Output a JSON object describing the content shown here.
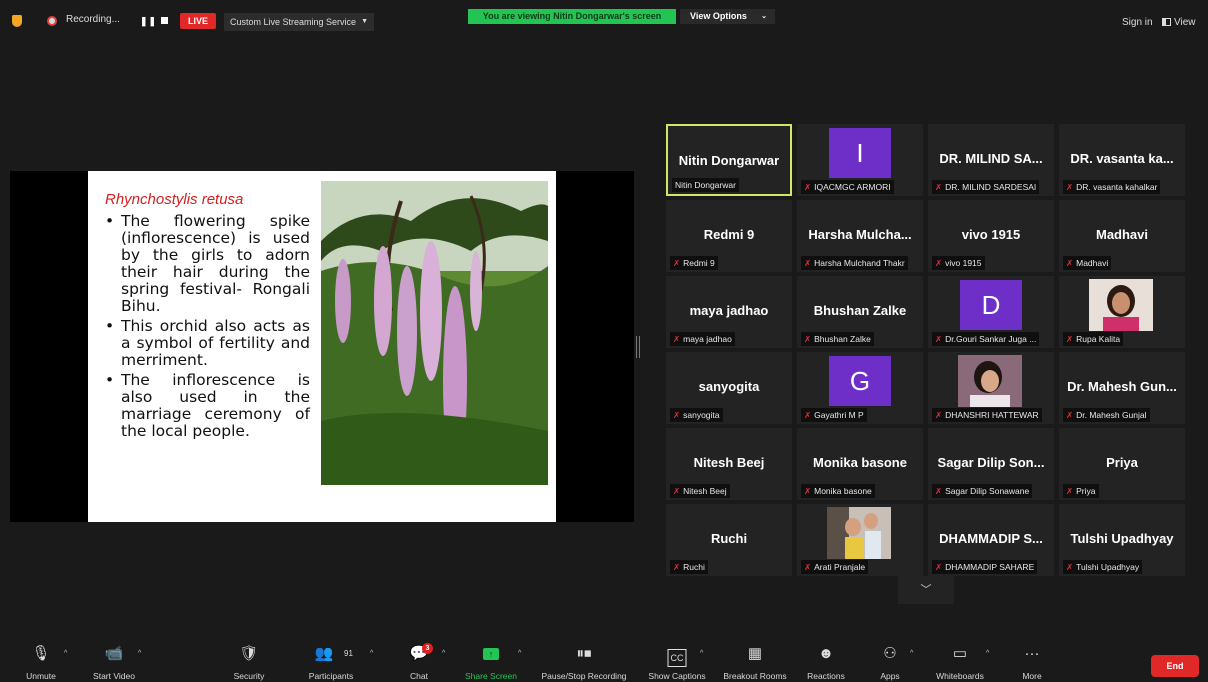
{
  "topbar": {
    "recording_label": "Recording...",
    "live_label": "LIVE",
    "stream_service": "Custom Live Streaming Service",
    "viewing_banner": "You are viewing Nitin Dongarwar's screen",
    "view_options": "View Options",
    "sign_in": "Sign in",
    "view": "View"
  },
  "slide": {
    "title": "Rhynchostylis retusa",
    "bullets": [
      "The flowering spike (inflorescence) is used by the girls to adorn their hair during the spring festival- Rongali Bihu.",
      "This orchid also acts as a symbol of fertility and merriment.",
      "The inflorescence is also used in the marriage ceremony of the local people."
    ]
  },
  "gallery": [
    {
      "display": "Nitin Dongarwar",
      "label": "Nitin Dongarwar",
      "type": "name",
      "active": true,
      "muted": false
    },
    {
      "display": "I",
      "label": "IQACMGC ARMORI",
      "type": "letter",
      "muted": true
    },
    {
      "display": "DR. MILIND SA...",
      "label": "DR. MILIND SARDESAI",
      "type": "name",
      "muted": true
    },
    {
      "display": "DR.  vasanta ka...",
      "label": "DR. vasanta kahalkar",
      "type": "name",
      "muted": true
    },
    {
      "display": "Redmi 9",
      "label": "Redmi 9",
      "type": "name",
      "muted": true
    },
    {
      "display": "Harsha  Mulcha...",
      "label": "Harsha Mulchand Thakr",
      "type": "name",
      "muted": true
    },
    {
      "display": "vivo 1915",
      "label": "vivo 1915",
      "type": "name",
      "muted": true
    },
    {
      "display": "Madhavi",
      "label": "Madhavi",
      "type": "name",
      "muted": true
    },
    {
      "display": "maya jadhao",
      "label": "maya jadhao",
      "type": "name",
      "muted": true
    },
    {
      "display": "Bhushan Zalke",
      "label": "Bhushan Zalke",
      "type": "name",
      "muted": true
    },
    {
      "display": "D",
      "label": "Dr.Gouri Sankar Juga ...",
      "type": "letter",
      "muted": true
    },
    {
      "display": "",
      "label": "Rupa Kalita",
      "type": "photo-woman",
      "muted": true
    },
    {
      "display": "sanyogita",
      "label": "sanyogita",
      "type": "name",
      "muted": true
    },
    {
      "display": "G",
      "label": "Gayathri M P",
      "type": "letter",
      "muted": true
    },
    {
      "display": "",
      "label": "DHANSHRI HATTEWAR",
      "type": "photo-girl",
      "muted": true
    },
    {
      "display": "Dr. Mahesh Gun...",
      "label": "Dr. Mahesh Gunjal",
      "type": "name",
      "muted": true
    },
    {
      "display": "Nitesh Beej",
      "label": "Nitesh Beej",
      "type": "name",
      "muted": true
    },
    {
      "display": "Monika basone",
      "label": "Monika basone",
      "type": "name",
      "muted": true
    },
    {
      "display": "Sagar Dilip Son...",
      "label": "Sagar Dilip Sonawane",
      "type": "name",
      "muted": true
    },
    {
      "display": "Priya",
      "label": "Priya",
      "type": "name",
      "muted": true
    },
    {
      "display": "Ruchi",
      "label": "Ruchi",
      "type": "name",
      "muted": true
    },
    {
      "display": "",
      "label": "Arati Pranjale",
      "type": "photo-kids",
      "muted": true
    },
    {
      "display": "DHAMMADIP  S...",
      "label": "DHAMMADIP SAHARE",
      "type": "name",
      "muted": true
    },
    {
      "display": "Tulshi Upadhyay",
      "label": "Tulshi Upadhyay",
      "type": "name",
      "muted": true
    }
  ],
  "toolbar": {
    "unmute": "Unmute",
    "start_video": "Start Video",
    "security": "Security",
    "participants": "Participants",
    "participants_count": "91",
    "chat": "Chat",
    "chat_badge": "3",
    "share_screen": "Share Screen",
    "pause_stop": "Pause/Stop Recording",
    "show_captions": "Show Captions",
    "breakout_rooms": "Breakout Rooms",
    "reactions": "Reactions",
    "apps": "Apps",
    "whiteboards": "Whiteboards",
    "more": "More",
    "end": "End"
  },
  "colors": {
    "accent_green": "#23c552",
    "live_red": "#e02828",
    "active_speaker": "#cfe76a",
    "avatar_purple": "#6e2fc9",
    "slide_title_red": "#d42020"
  }
}
